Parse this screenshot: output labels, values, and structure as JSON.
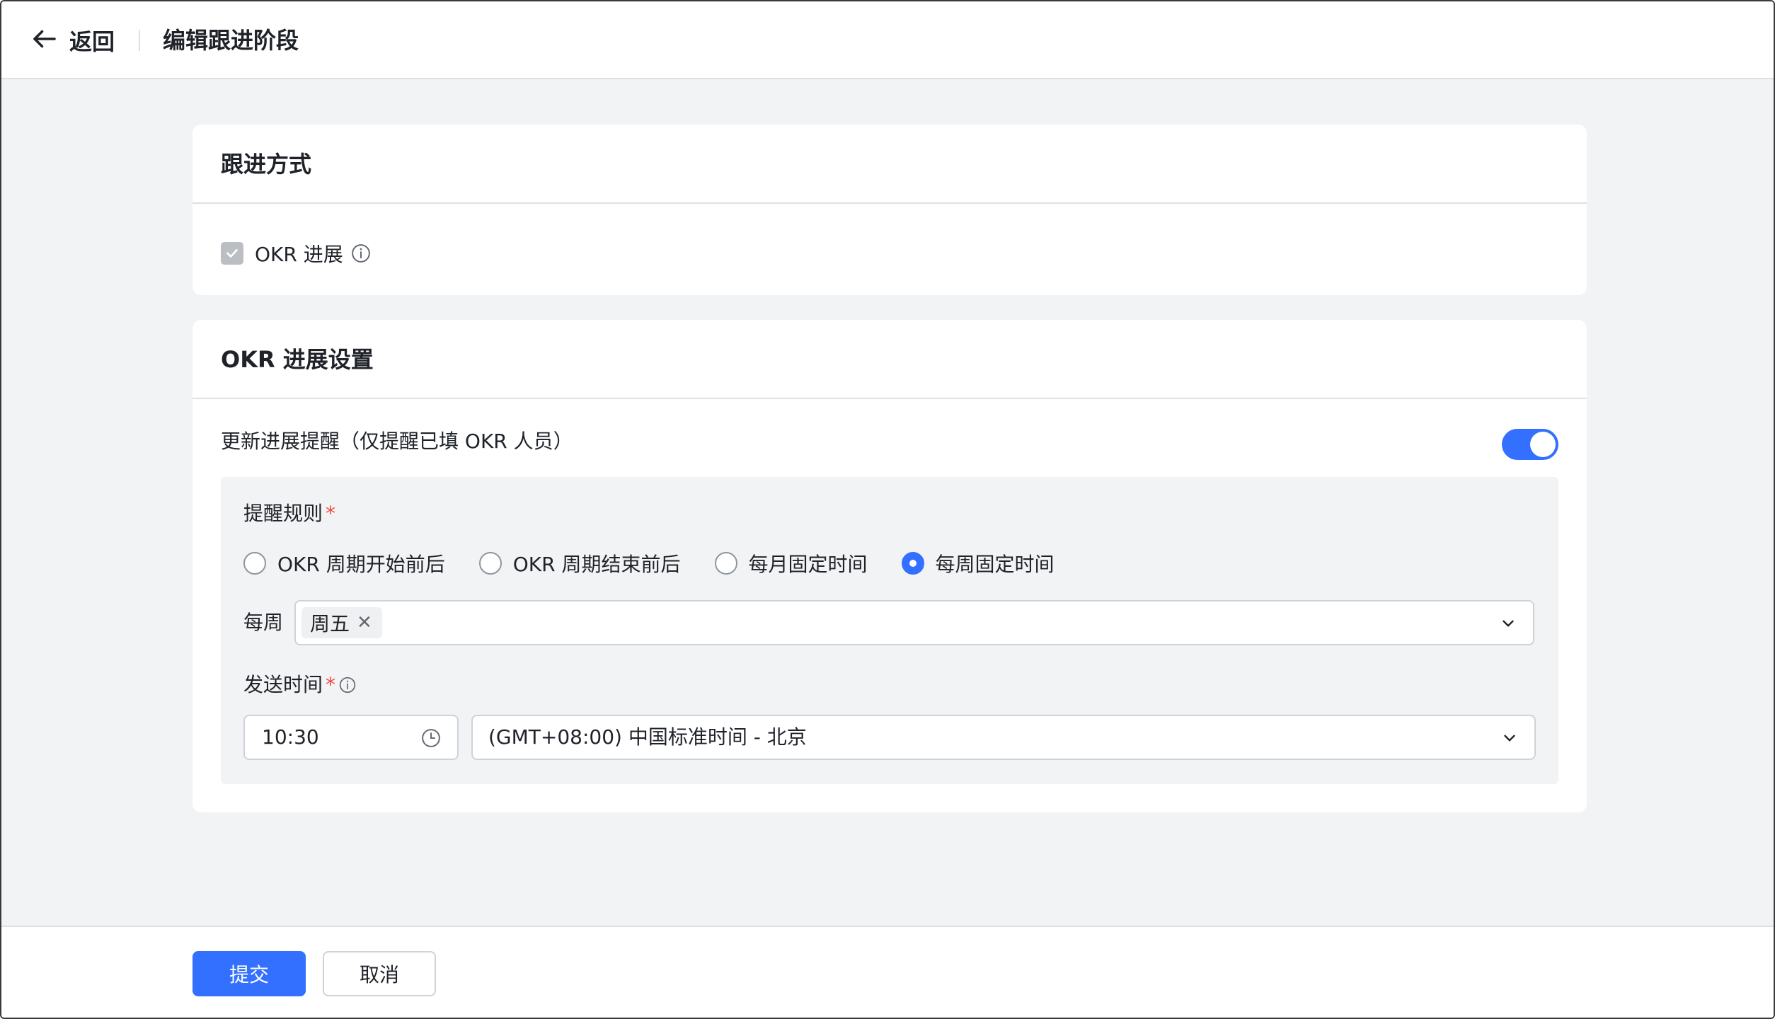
{
  "header": {
    "back_label": "返回",
    "title": "编辑跟进阶段"
  },
  "follow_method": {
    "title": "跟进方式",
    "checkbox_label": "OKR 进展",
    "checkbox_checked": true,
    "checkbox_disabled": true
  },
  "progress_settings": {
    "title": "OKR 进展设置",
    "reminder_label": "更新进展提醒（仅提醒已填 OKR 人员）",
    "reminder_enabled": true,
    "rule_label": "提醒规则",
    "required_mark": "*",
    "rule_options": [
      {
        "label": "OKR 周期开始前后",
        "selected": false
      },
      {
        "label": "OKR 周期结束前后",
        "selected": false
      },
      {
        "label": "每月固定时间",
        "selected": false
      },
      {
        "label": "每周固定时间",
        "selected": true
      }
    ],
    "weekly_label": "每周",
    "weekly_selected": [
      "周五"
    ],
    "tag_close": "✕",
    "send_time_label": "发送时间",
    "send_time_value": "10:30",
    "timezone_value": "(GMT+08:00) 中国标准时间 - 北京"
  },
  "footer": {
    "submit_label": "提交",
    "cancel_label": "取消"
  },
  "colors": {
    "primary": "#3370ff",
    "background": "#f2f3f5",
    "required": "#f54a45"
  }
}
